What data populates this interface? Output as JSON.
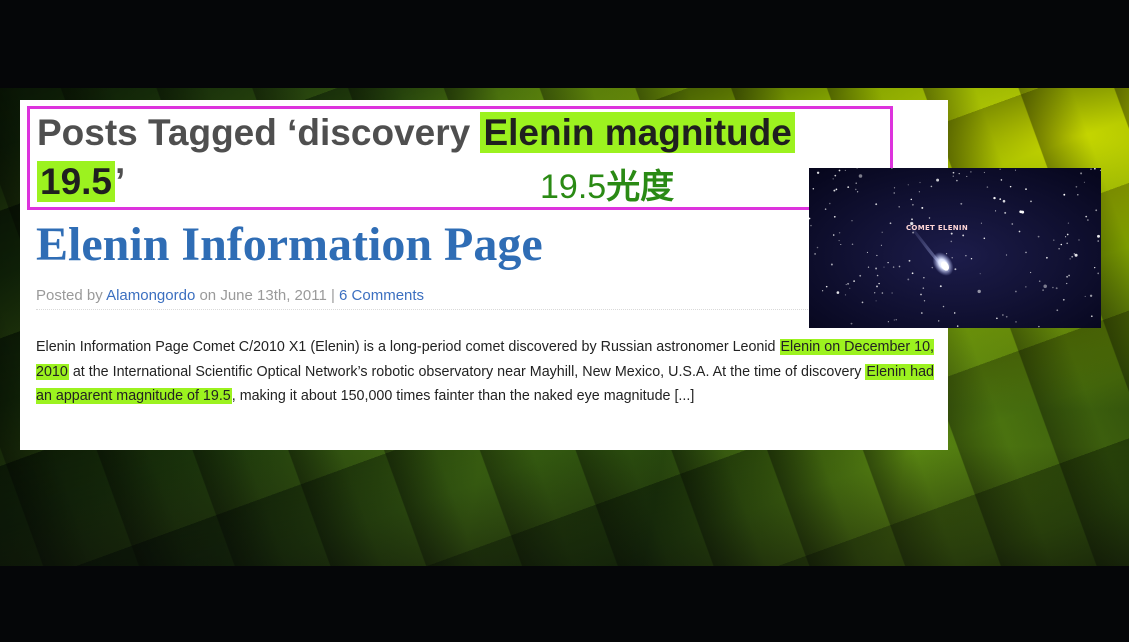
{
  "slide": {
    "heading": {
      "prefix": "Posts Tagged ‘discovery ",
      "highlight_1": "Elenin magnitude",
      "highlight_2": "19.5",
      "suffix": "’"
    },
    "annotation": {
      "number": "19.5",
      "cjk": "光度"
    },
    "post": {
      "title": "Elenin Information Page",
      "meta": {
        "posted_by": "Posted by ",
        "author": "Alamongordo",
        "on_date": " on June 13th, 2011 | ",
        "comments": "6 Comments"
      },
      "excerpt": {
        "part1": "Elenin Information Page Comet C/2010 X1 (Elenin) is a long-period comet discovered by Russian astronomer Leonid ",
        "mark1": "Elenin on December 10, 2010",
        "part2": " at the International Scientific Optical Network’s robotic observatory near Mayhill, New Mexico, U.S.A. At the time of discovery ",
        "mark2": "Elenin had an apparent magnitude of 19.5",
        "part3": ", making it about 150,000 times fainter than the naked eye magnitude [...]"
      }
    },
    "image": {
      "label": "COMET ELENIN",
      "icon": "comet-photo"
    },
    "colors": {
      "highlight": "#9cf21f",
      "heading_box_border": "#dd33dd",
      "title_blue": "#2f6db5",
      "annotation_green": "#2a8a14"
    }
  }
}
